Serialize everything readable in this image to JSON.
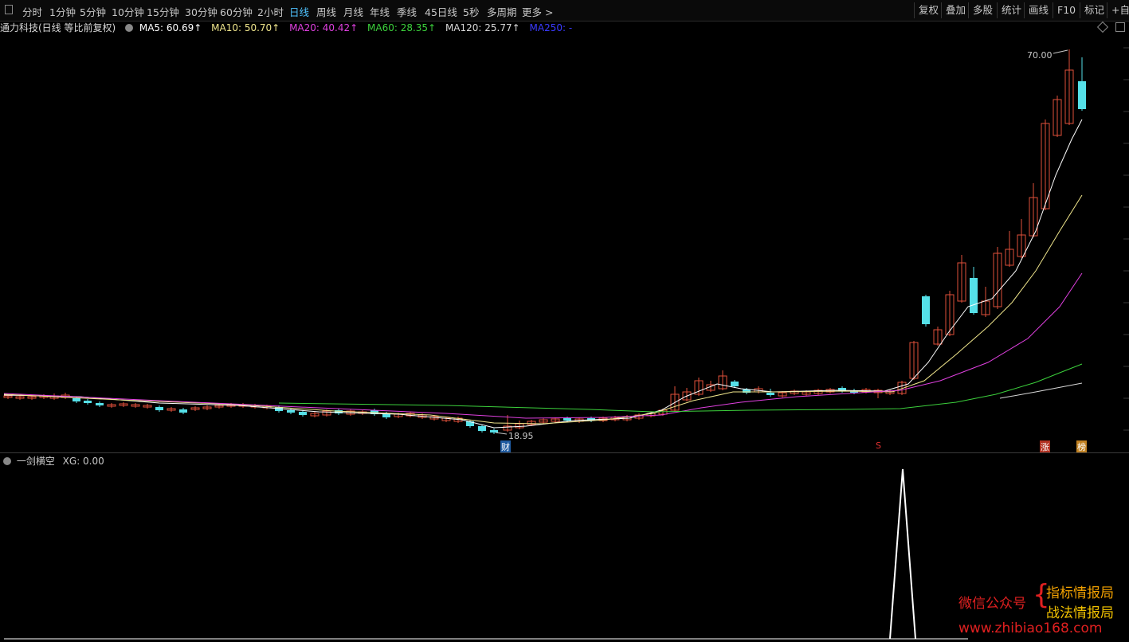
{
  "toolbar": {
    "periods": [
      "分时",
      "1分钟",
      "5分钟",
      "10分钟",
      "15分钟",
      "30分钟",
      "60分钟",
      "2小时",
      "日线",
      "周线",
      "月线",
      "年线",
      "季线",
      "45日线",
      "5秒",
      "多周期",
      "更多 >"
    ],
    "active_period": "日线",
    "right_buttons": [
      "复权",
      "叠加",
      "多股",
      "统计",
      "画线",
      "F10",
      "标记",
      "+自选"
    ]
  },
  "legend": {
    "title": "通力科技(日线 等比前复权)",
    "ma5": "MA5: 60.69↑",
    "ma10": "MA10: 50.70↑",
    "ma20": "MA20: 40.42↑",
    "ma60": "MA60: 28.35↑",
    "ma120": "MA120: 25.77↑",
    "ma250": "MA250: -"
  },
  "colors": {
    "ma5": "#ffffff",
    "ma10": "#f0e68c",
    "ma20": "#e040e0",
    "ma60": "#3cd03c",
    "ma120": "#d8d8d8",
    "ma250": "#3a3aff",
    "up": "#e0503a",
    "down": "#55e0e8"
  },
  "chart": {
    "high_label": "70.00",
    "low_label": "18.95",
    "markers": {
      "cai": "财",
      "s": "S",
      "zhang": "涨",
      "bang": "榜"
    }
  },
  "sub_chart": {
    "indicator_name": "一剑横空",
    "value": "XG: 0.00"
  },
  "chart_data": {
    "type": "candlestick",
    "high": 70.0,
    "low": 18.95,
    "ma_values": {
      "MA5": 60.69,
      "MA10": 50.7,
      "MA20": 40.42,
      "MA60": 28.35,
      "MA120": 25.77
    }
  },
  "watermark": {
    "left": "微信公众号",
    "line1": "指标情报局",
    "line2": "战法情报局",
    "url": "www.zhibiao168.com"
  }
}
